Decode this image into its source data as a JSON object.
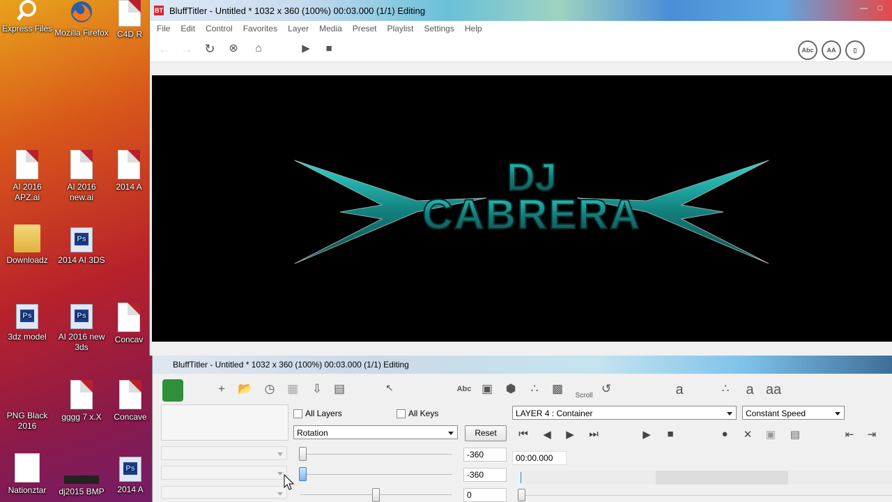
{
  "desktop": {
    "icons": [
      {
        "label": "Express Files",
        "type": "shortcut"
      },
      {
        "label": "Mozilla Firefox",
        "type": "firefox"
      },
      {
        "label": "C4D R",
        "type": "file"
      },
      {
        "label": "AI 2016 APZ.ai",
        "type": "file"
      },
      {
        "label": "AI 2016 new.ai",
        "type": "file"
      },
      {
        "label": "2014 A",
        "type": "file"
      },
      {
        "label": "Downloadz",
        "type": "folder"
      },
      {
        "label": "2014 AI 3DS",
        "type": "psd"
      },
      {
        "label": "3dz model",
        "type": "psd"
      },
      {
        "label": "AI 2016 new 3ds",
        "type": "psd"
      },
      {
        "label": "Concav",
        "type": "file"
      },
      {
        "label": "PNG Black 2016",
        "type": "file"
      },
      {
        "label": "gggg 7 x.X",
        "type": "file"
      },
      {
        "label": "Concave",
        "type": "file"
      },
      {
        "label": "Nationztar",
        "type": "image"
      },
      {
        "label": "dj2015 BMP",
        "type": "image"
      },
      {
        "label": "2014 A",
        "type": "psd"
      }
    ]
  },
  "main_window": {
    "app_icon_text": "BT",
    "title": "BluffTitler - Untitled * 1032 x 360 (100%) 00:03.000 (1/1) Editing",
    "menu": [
      "File",
      "Edit",
      "Control",
      "Favorites",
      "Layer",
      "Media",
      "Preset",
      "Playlist",
      "Settings",
      "Help"
    ],
    "toolbar_right": [
      "Abc",
      "AA",
      "▯"
    ],
    "stage_title_top": "DJ",
    "stage_title_main": "CABRERA"
  },
  "editor_window": {
    "title": "BluffTitler - Untitled * 1032 x 360 (100%) 00:03.000 (1/1) Editing",
    "toolbar_text": {
      "abc": "Abc",
      "scroll": "Scroll",
      "a1": "a",
      "a2": "a",
      "aa": "aa"
    },
    "all_layers_label": "All Layers",
    "all_keys_label": "All Keys",
    "property_select": "Rotation",
    "reset_label": "Reset",
    "layer_select": "LAYER 4  : Container",
    "speed_select": "Constant Speed",
    "values": [
      "-360",
      "-360",
      "0"
    ],
    "time_value": "00:00.000"
  },
  "colors": {
    "title_accent": "#1aa7a3",
    "stage_bg": "#000000"
  }
}
